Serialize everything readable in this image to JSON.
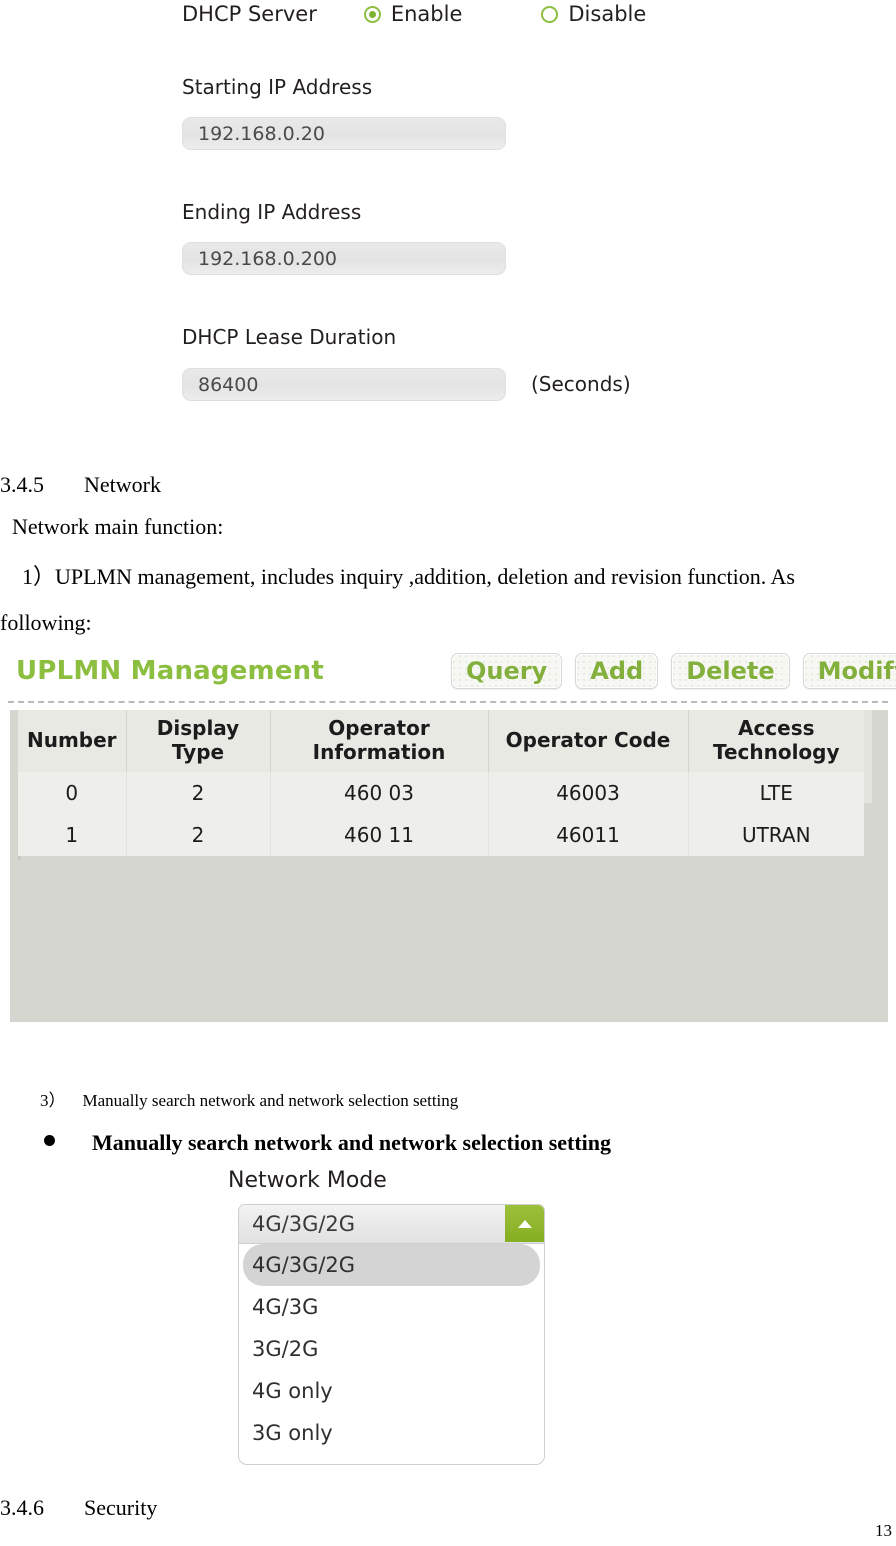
{
  "dhcp_panel": {
    "server_label": "DHCP Server",
    "radios": [
      {
        "label": "Enable",
        "checked": true
      },
      {
        "label": "Disable",
        "checked": false
      }
    ],
    "fields": [
      {
        "label": "Starting IP Address",
        "value": "192.168.0.20",
        "note": ""
      },
      {
        "label": "Ending IP Address",
        "value": "192.168.0.200",
        "note": ""
      },
      {
        "label": "DHCP Lease Duration",
        "value": "86400",
        "note": "(Seconds)"
      }
    ]
  },
  "document": {
    "section_network": {
      "number": "3.4.5",
      "title": "Network"
    },
    "intro": "Network main function:",
    "item1": "1）UPLMN management, includes inquiry ,addition, deletion and revision function. As",
    "item1_cont": "following:",
    "item3_small": "3） Manually search network and network selection setting",
    "item3_bullet": "Manually search network and network selection setting",
    "section_security": {
      "number": "3.4.6",
      "title": "Security"
    },
    "page_number": "13"
  },
  "uplmn_panel": {
    "title": "UPLMN Management",
    "buttons": [
      "Query",
      "Add",
      "Delete",
      "Modify"
    ],
    "table": {
      "headers": [
        "Number",
        "Display Type",
        "Operator Information",
        "Operator Code",
        "Access Technology"
      ],
      "rows": [
        [
          "0",
          "2",
          "460 03",
          "46003",
          "LTE"
        ],
        [
          "1",
          "2",
          "460 11",
          "46011",
          "UTRAN"
        ]
      ]
    }
  },
  "network_mode": {
    "label": "Network Mode",
    "selected": "4G/3G/2G",
    "options": [
      "4G/3G/2G",
      "4G/3G",
      "3G/2G",
      "4G only",
      "3G only"
    ],
    "arrow_icon": "chevron-up-icon"
  },
  "colors": {
    "accent_green": "#8cbe3f",
    "button_green": "#83af3c",
    "field_gray": "#e6e6e6"
  }
}
